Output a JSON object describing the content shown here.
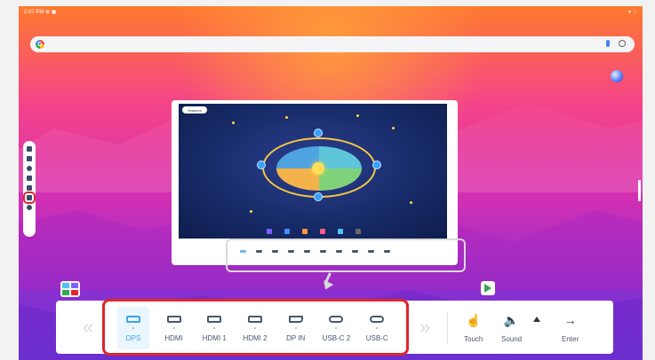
{
  "status": {
    "time_text": "2:07 PM",
    "left_icons": "⊗ ▣",
    "right_icons": "▾ ♡"
  },
  "search": {
    "logo": "G",
    "mic_icon": "mic-icon",
    "lens_icon": "lens-icon"
  },
  "preview": {
    "pill_text": "Seasons",
    "dock_colors": [
      "#7b61ff",
      "#4a8cff",
      "#ff9a3c",
      "#ff5b8a",
      "#4fc3f7",
      "#6a6a6a"
    ]
  },
  "source_bar": {
    "nav_prev": "«",
    "nav_next": "»",
    "sources": [
      {
        "label": "OPS",
        "icon": "ops-icon",
        "selected": true
      },
      {
        "label": "HDMI",
        "icon": "hdmi-icon",
        "selected": false
      },
      {
        "label": "HDMI 1",
        "icon": "hdmi-icon",
        "selected": false
      },
      {
        "label": "HDMI 2",
        "icon": "hdmi-icon",
        "selected": false
      },
      {
        "label": "DP IN",
        "icon": "displayport-icon",
        "selected": false
      },
      {
        "label": "USB-C 2",
        "icon": "usb-c-icon",
        "selected": false
      },
      {
        "label": "USB-C",
        "icon": "usb-c-icon",
        "selected": false
      }
    ],
    "controls": {
      "touch_label": "Touch",
      "sound_label": "Sound",
      "enter_label": "Enter",
      "touch_glyph": "☝",
      "sound_glyph": "🔈",
      "enter_glyph": "→"
    }
  },
  "colors": {
    "highlight_red": "#e0262b",
    "selected_blue": "#3aa3e8",
    "icon_gray": "#4a5672"
  }
}
